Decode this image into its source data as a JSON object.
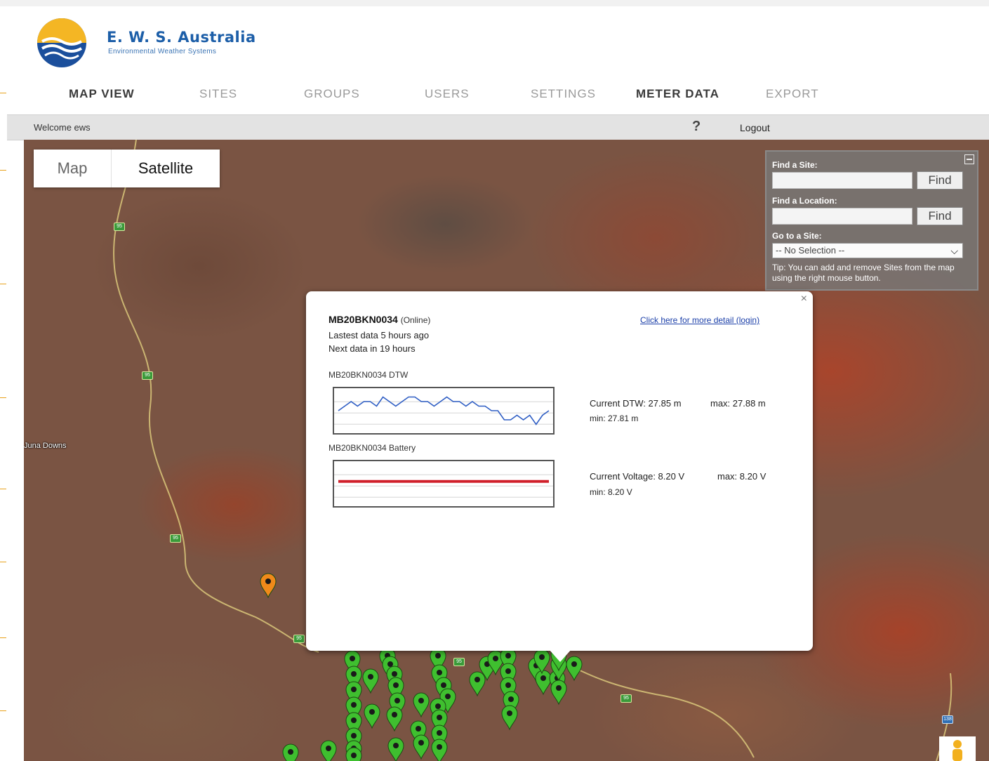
{
  "brand": {
    "title": "E. W. S.  Australia",
    "subtitle": "Environmental Weather Systems"
  },
  "nav": {
    "items": [
      {
        "label": "MAP VIEW",
        "active": true
      },
      {
        "label": "SITES",
        "active": false
      },
      {
        "label": "GROUPS",
        "active": false
      },
      {
        "label": "USERS",
        "active": false
      },
      {
        "label": "SETTINGS",
        "active": false
      },
      {
        "label": "METER DATA",
        "active": true
      },
      {
        "label": "EXPORT",
        "active": false
      }
    ]
  },
  "session": {
    "welcome": "Welcome ews",
    "help": "?",
    "logout": "Logout"
  },
  "map": {
    "type_controls": {
      "map": "Map",
      "satellite": "Satellite",
      "selected": "Satellite"
    },
    "place_label": "Juna Downs",
    "road_shields": [
      "95",
      "95",
      "95",
      "95",
      "95",
      "95",
      "95",
      "138"
    ]
  },
  "search_panel": {
    "find_site_label": "Find a Site:",
    "find_location_label": "Find a Location:",
    "find_button": "Find",
    "goto_label": "Go to a Site:",
    "goto_selected": "-- No Selection --",
    "tip": "Tip: You can add and remove Sites from the map using the right mouse button."
  },
  "popup": {
    "site_id": "MB20BKN0034",
    "status": "(Online)",
    "latest": "Lastest data 5 hours ago",
    "next": "Next data in 19 hours",
    "detail_link": "Click here for more detail (login)",
    "close": "×",
    "dtw_chart_title": "MB20BKN0034 DTW",
    "battery_chart_title": "MB20BKN0034 Battery",
    "dtw_current": "Current DTW: 27.85 m",
    "dtw_max": "max: 27.88 m",
    "dtw_min": "min: 27.81 m",
    "volt_current": "Current Voltage: 8.20 V",
    "volt_max": "max: 8.20 V",
    "volt_min": "min: 8.20 V",
    "dtw_series": [
      27.84,
      27.85,
      27.86,
      27.85,
      27.86,
      27.86,
      27.85,
      27.87,
      27.86,
      27.85,
      27.86,
      27.87,
      27.87,
      27.86,
      27.86,
      27.85,
      27.86,
      27.87,
      27.86,
      27.86,
      27.85,
      27.86,
      27.85,
      27.85,
      27.84,
      27.84,
      27.82,
      27.82,
      27.83,
      27.82,
      27.83,
      27.81,
      27.83,
      27.84
    ],
    "battery_series": [
      8.2,
      8.2,
      8.2,
      8.2,
      8.2,
      8.2,
      8.2,
      8.2,
      8.2,
      8.2
    ],
    "colors": {
      "dtw_line": "#2f5ec4",
      "battery_line": "#d0202a"
    }
  },
  "markers": {
    "green_color": "#3fbf2f",
    "orange_color": "#f08a1a"
  }
}
